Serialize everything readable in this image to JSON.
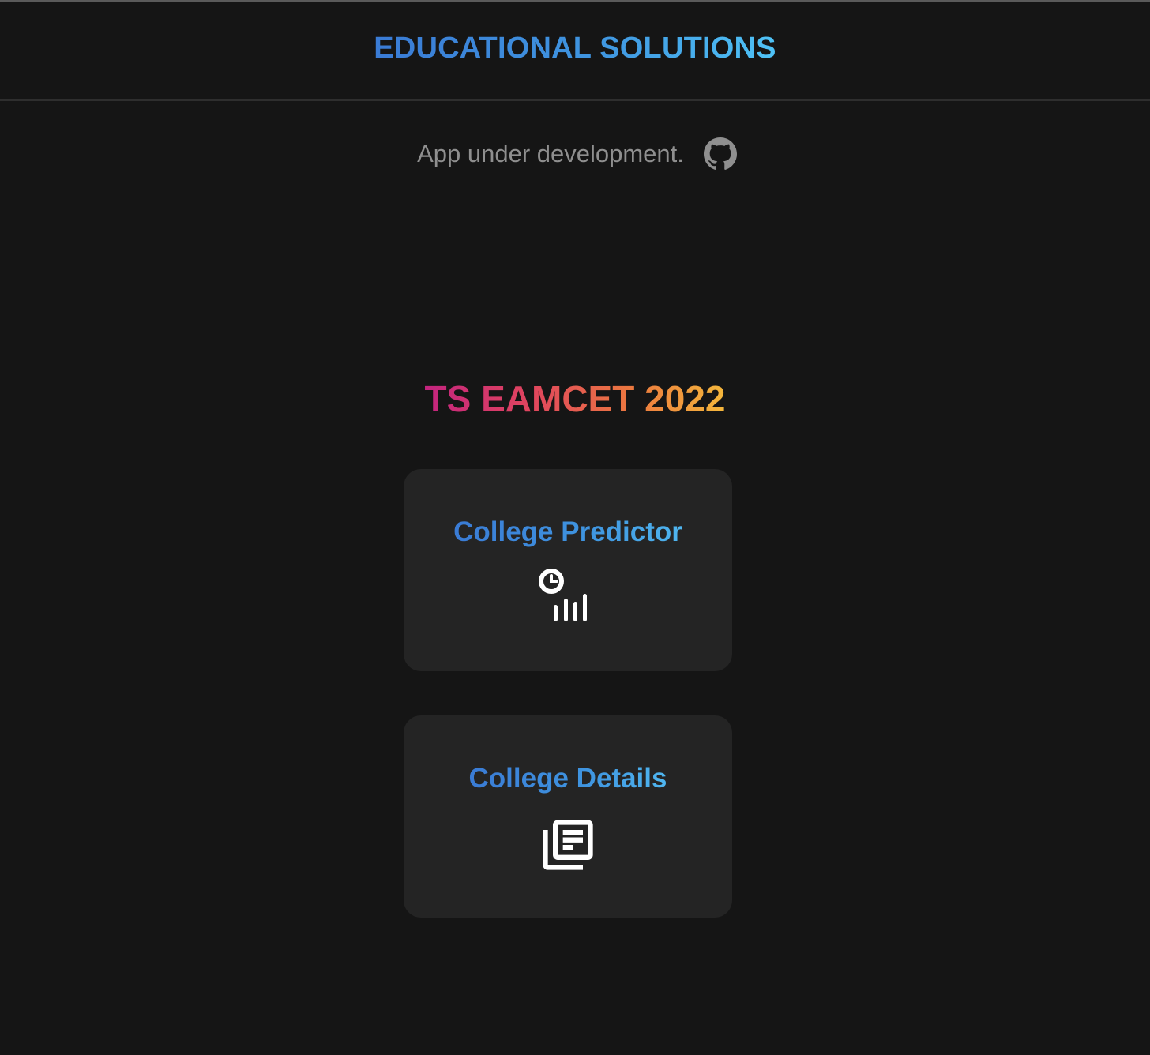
{
  "header": {
    "brand": "EDUCATIONAL SOLUTIONS"
  },
  "notice": {
    "text": "App under development.",
    "icon": "github-icon"
  },
  "section": {
    "title": "TS EAMCET 2022"
  },
  "cards": [
    {
      "label": "College Predictor",
      "icon": "analytics-icon"
    },
    {
      "label": "College Details",
      "icon": "library-books-icon"
    }
  ],
  "colors": {
    "background": "#151515",
    "card_background": "#242424",
    "brand_gradient_start": "#3a7bd5",
    "brand_gradient_end": "#4fc3f7",
    "title_gradient_start": "#c3247f",
    "title_gradient_end": "#f4b73c",
    "muted_text": "#8f8f8f"
  }
}
